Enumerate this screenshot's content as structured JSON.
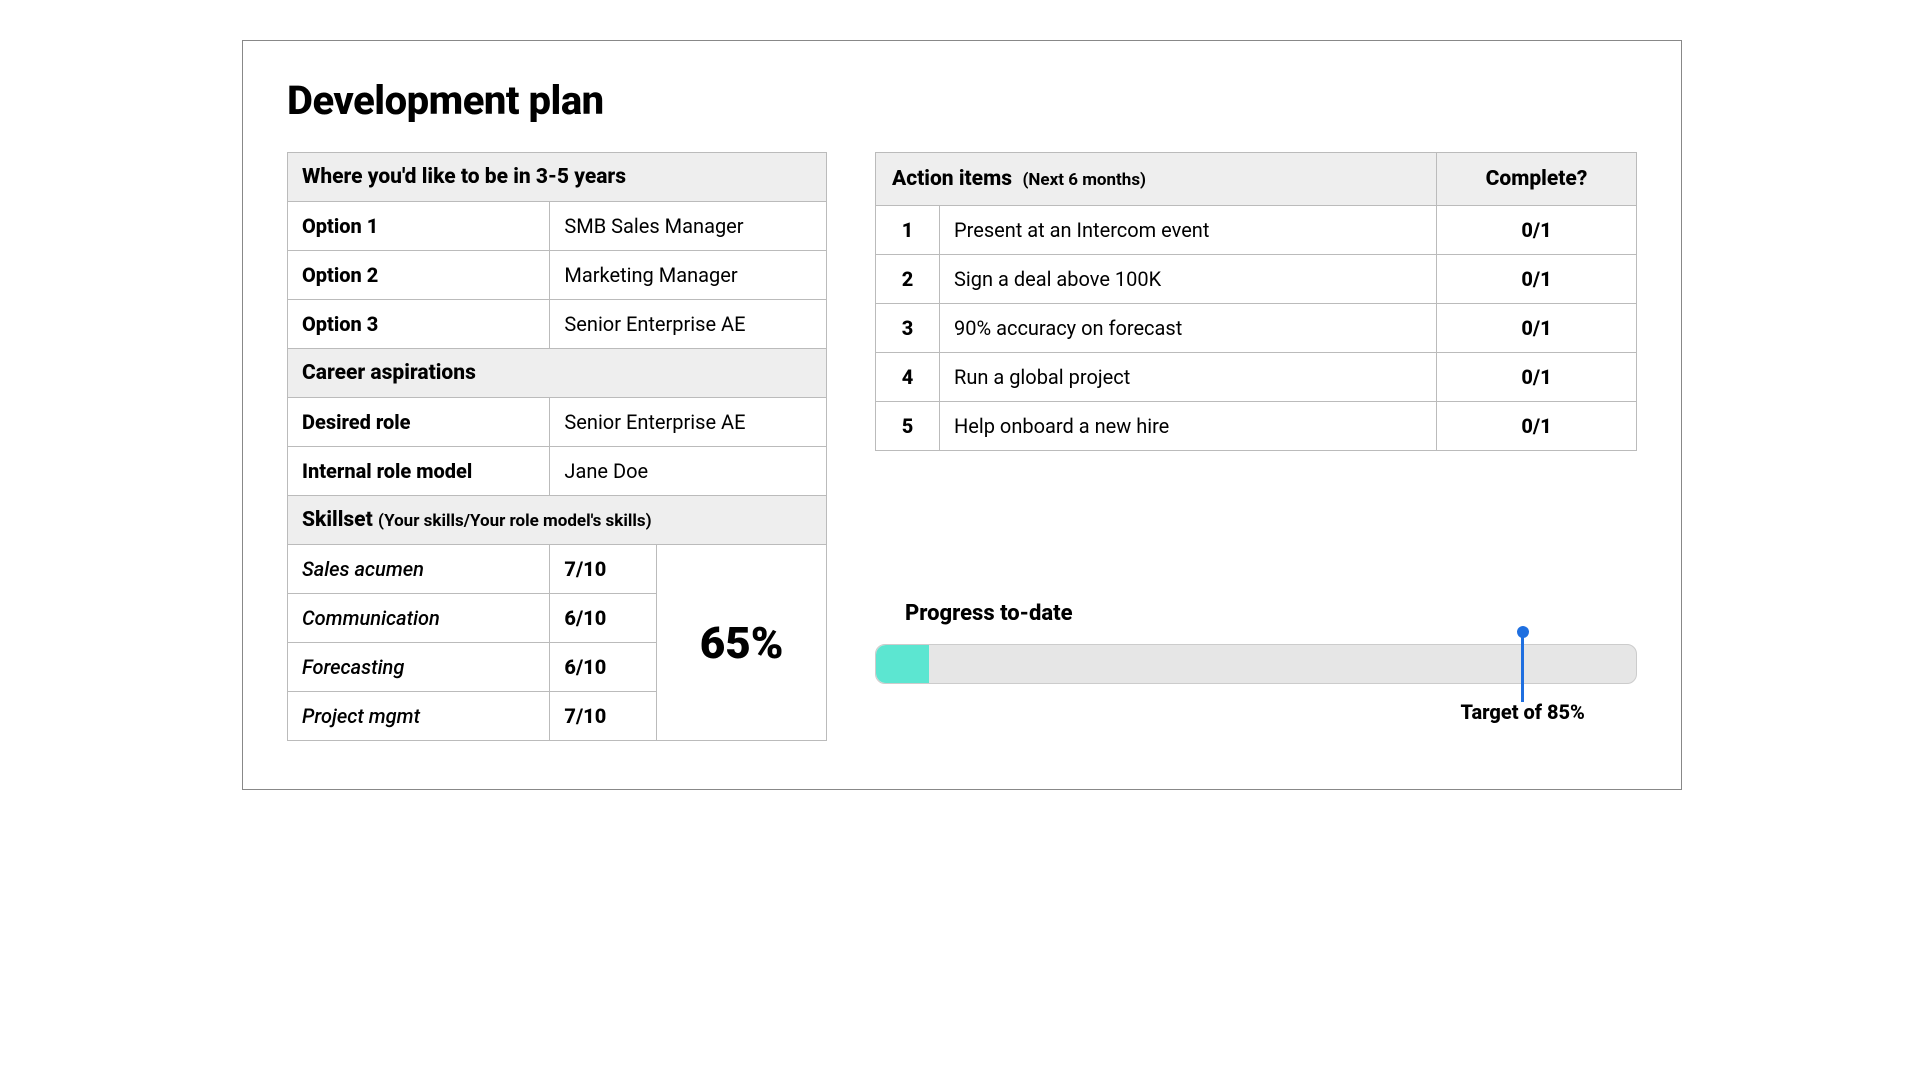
{
  "title": "Development plan",
  "future": {
    "header": "Where you'd like to be in 3-5 years",
    "options": [
      {
        "label": "Option 1",
        "value": "SMB Sales Manager"
      },
      {
        "label": "Option 2",
        "value": "Marketing Manager"
      },
      {
        "label": "Option 3",
        "value": "Senior Enterprise AE"
      }
    ]
  },
  "aspirations": {
    "header": "Career aspirations",
    "rows": [
      {
        "label": "Desired role",
        "value": "Senior Enterprise AE"
      },
      {
        "label": "Internal role model",
        "value": "Jane Doe"
      }
    ]
  },
  "skillset": {
    "header": "Skillset",
    "sub": "(Your skills/Your role model's skills)",
    "rows": [
      {
        "name": "Sales acumen",
        "score": "7/10"
      },
      {
        "name": "Communication",
        "score": "6/10"
      },
      {
        "name": "Forecasting",
        "score": "6/10"
      },
      {
        "name": "Project mgmt",
        "score": "7/10"
      }
    ],
    "total": "65%"
  },
  "actions": {
    "header": "Action items",
    "sub": "(Next 6 months)",
    "complete_header": "Complete?",
    "items": [
      {
        "num": "1",
        "desc": "Present at an Intercom event",
        "complete": "0/1"
      },
      {
        "num": "2",
        "desc": "Sign a deal above 100K",
        "complete": "0/1"
      },
      {
        "num": "3",
        "desc": "90% accuracy on forecast",
        "complete": "0/1"
      },
      {
        "num": "4",
        "desc": "Run a global project",
        "complete": "0/1"
      },
      {
        "num": "5",
        "desc": "Help onboard a new hire",
        "complete": "0/1"
      }
    ]
  },
  "progress": {
    "title": "Progress to-date",
    "fill_percent": 7,
    "target_percent": 85,
    "target_label": "Target of 85%"
  }
}
